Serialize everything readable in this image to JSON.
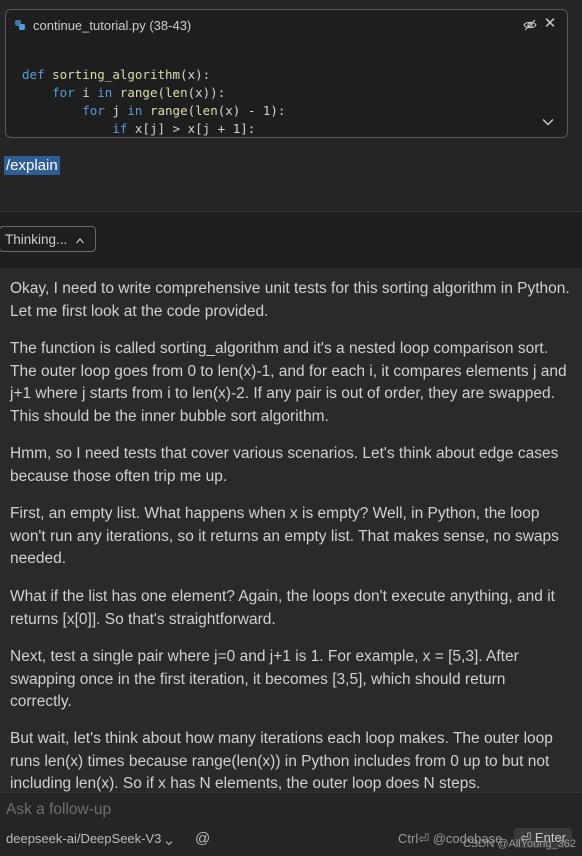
{
  "context_card": {
    "file_label": "continue_tutorial.py (38-43)",
    "code_lines": [
      {
        "indent": "",
        "parts": [
          {
            "t": "def ",
            "c": "kw"
          },
          {
            "t": "sorting_algorithm",
            "c": "fn"
          },
          {
            "t": "(x):",
            "c": ""
          }
        ]
      },
      {
        "indent": "    ",
        "parts": [
          {
            "t": "for ",
            "c": "kw"
          },
          {
            "t": "i ",
            "c": ""
          },
          {
            "t": "in ",
            "c": "kw"
          },
          {
            "t": "range",
            "c": "fn"
          },
          {
            "t": "(",
            "c": ""
          },
          {
            "t": "len",
            "c": "fn"
          },
          {
            "t": "(x)):",
            "c": ""
          }
        ]
      },
      {
        "indent": "        ",
        "parts": [
          {
            "t": "for ",
            "c": "kw"
          },
          {
            "t": "j ",
            "c": ""
          },
          {
            "t": "in ",
            "c": "kw"
          },
          {
            "t": "range",
            "c": "fn"
          },
          {
            "t": "(",
            "c": ""
          },
          {
            "t": "len",
            "c": "fn"
          },
          {
            "t": "(x) - 1):",
            "c": ""
          }
        ]
      },
      {
        "indent": "            ",
        "parts": [
          {
            "t": "if ",
            "c": "kw"
          },
          {
            "t": "x[j] > x[j + 1]:",
            "c": ""
          }
        ]
      }
    ]
  },
  "slash_command": "/explain",
  "thinking": {
    "label": "Thinking..."
  },
  "response": {
    "paragraphs": [
      "Okay, I need to write comprehensive unit tests for this sorting algorithm in Python. Let me first look at the code provided.",
      "The function is called sorting_algorithm and it's a nested loop comparison sort. The outer loop goes from 0 to len(x)-1, and for each i, it compares elements j and j+1 where j starts from i to len(x)-2. If any pair is out of order, they are swapped. This should be the inner bubble sort algorithm.",
      "Hmm, so I need tests that cover various scenarios. Let's think about edge cases because those often trip me up.",
      "First, an empty list. What happens when x is empty? Well, in Python, the loop won't run any iterations, so it returns an empty list. That makes sense, no swaps needed.",
      "What if the list has one element? Again, the loops don't execute anything, and it returns [x[0]]. So that's straightforward.",
      "Next, test a single pair where j=0 and j+1 is 1. For example, x = [5,3]. After swapping once in the first iteration, it becomes [3,5], which should return correctly.",
      "But wait, let's think about how many iterations each loop makes. The outer loop runs len(x) times because range(len(x)) in Python includes from 0 up to but not including len(x). So if x has N elements, the outer loop does N steps."
    ]
  },
  "input": {
    "placeholder": "Ask a follow-up",
    "model": "deepseek-ai/DeepSeek-V3",
    "at_symbol": "@",
    "ctrl_hint": "Ctrl⏎ @codebase",
    "enter_label": "⏎ Enter"
  },
  "watermark": "CSDN @AllYoung_362"
}
